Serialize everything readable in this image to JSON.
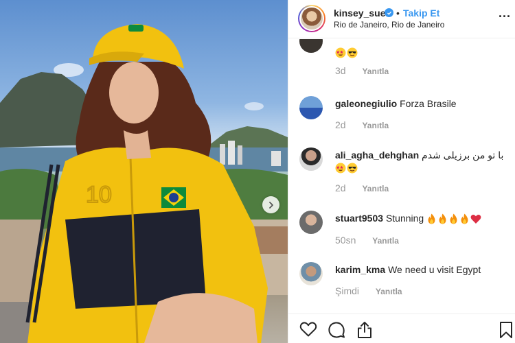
{
  "post": {
    "username": "kinsey_sue",
    "separator": "•",
    "follow_label": "Takip Et",
    "location": "Rio de Janeiro, Rio de Janeiro"
  },
  "comments": [
    {
      "username": "",
      "text": "",
      "emojis": [
        "star-struck",
        "sunglasses"
      ],
      "time": "3d",
      "reply_label": "Yanıtla"
    },
    {
      "username": "galeonegiulio",
      "text": "Forza Brasile",
      "emojis": [],
      "time": "2d",
      "reply_label": "Yanıtla"
    },
    {
      "username": "ali_agha_dehghan",
      "text": "با تو من برزیلی شدم",
      "emojis": [
        "star-struck",
        "sunglasses"
      ],
      "time": "2d",
      "reply_label": "Yanıtla"
    },
    {
      "username": "stuart9503",
      "text": "Stunning",
      "emojis": [
        "fire",
        "fire",
        "fire",
        "fire",
        "red-heart"
      ],
      "time": "50sn",
      "reply_label": "Yanıtla"
    },
    {
      "username": "karim_kma",
      "text": "We need u visit Egypt",
      "emojis": [],
      "time": "Şimdi",
      "reply_label": "Yanıtla"
    }
  ],
  "icons": {
    "like": "heart-icon",
    "comment": "comment-icon",
    "share": "share-icon",
    "save": "bookmark-icon",
    "more": "more-options-icon",
    "next": "chevron-right-icon",
    "verified": "verified-badge-icon"
  },
  "colors": {
    "link_blue": "#3897f0",
    "text": "#262626",
    "muted": "#999999",
    "border": "#efefef"
  }
}
